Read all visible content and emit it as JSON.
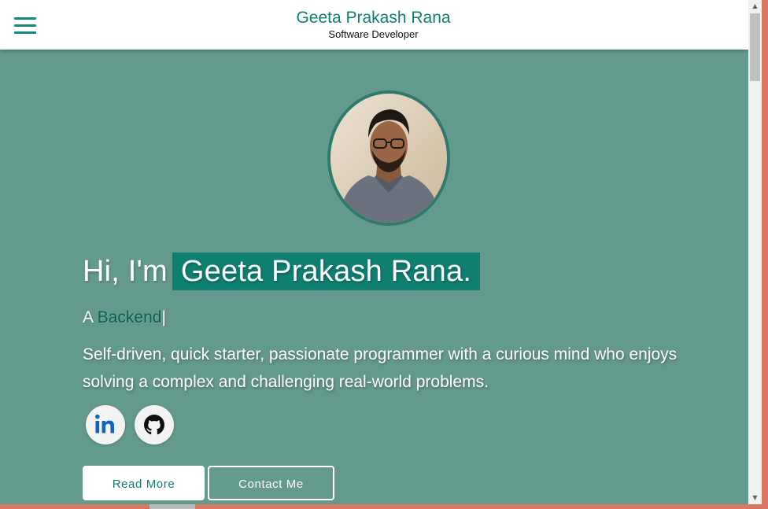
{
  "header": {
    "brand_name": "Geeta Prakash Rana",
    "brand_subtitle": "Software Developer",
    "menu_icon": "hamburger-menu-icon"
  },
  "hero": {
    "greeting": "Hi, I'm",
    "name_highlight": "Geeta Prakash Rana.",
    "typed_prefix": "A",
    "typed_role": "Backend",
    "typed_caret": "|",
    "bio": "Self-driven, quick starter, passionate programmer with a curious mind who enjoys solving a complex and challenging real-world problems.",
    "avatar_alt": "profile photo"
  },
  "social": {
    "linkedin_icon": "linkedin-icon",
    "github_icon": "github-icon"
  },
  "buttons": {
    "read_more": "Read More",
    "contact_me": "Contact Me"
  },
  "colors": {
    "accent": "#0f7f72",
    "hero_background": "#649a8d",
    "header_background": "#ffffff",
    "avatar_border": "#2f7a6c"
  }
}
